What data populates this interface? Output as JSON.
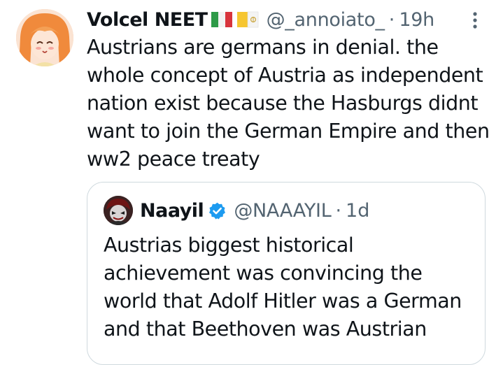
{
  "tweet": {
    "display_name": "Volcel NEET",
    "handle": "@_annoiato_",
    "separator": "·",
    "time": "19h",
    "text": "Austrians are germans in denial. the whole concept of Austria as independent nation exist because the Hasburgs didnt want to join the German Empire and then ww2 peace treaty"
  },
  "quote": {
    "display_name": "Naayil",
    "handle": "@NAAAYIL",
    "separator": "·",
    "time": "1d",
    "text": "Austrias biggest historical achievement was convincing the world that Adolf Hitler was a German and that Beethoven was Austrian"
  },
  "icons": {
    "flag_1": "italy-flag-icon",
    "flag_2": "vatican-flag-icon",
    "verified": "verified-badge-icon",
    "more": "more-vertical-icon"
  },
  "colors": {
    "text": "#0f1419",
    "secondary": "#536471",
    "border": "#cfd9de",
    "verified": "#1d9bf0"
  }
}
